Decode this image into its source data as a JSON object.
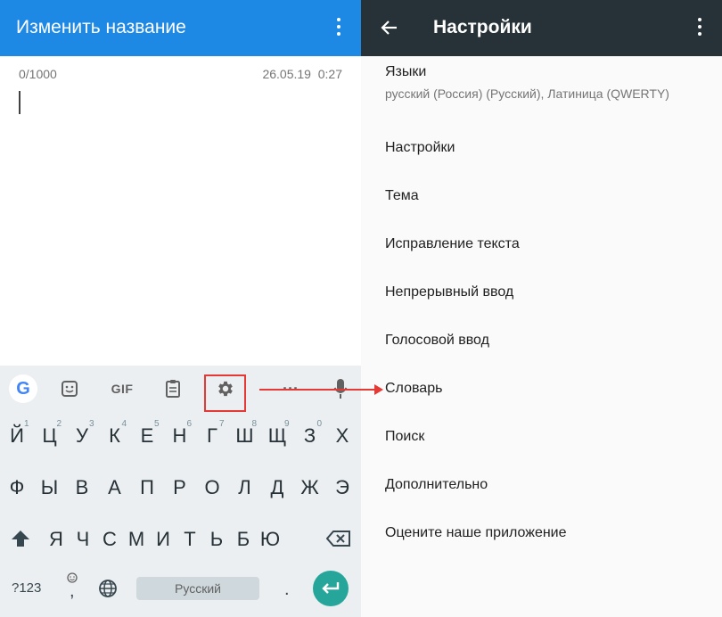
{
  "left": {
    "title": "Изменить название",
    "counter": "0/1000",
    "date": "26.05.19",
    "time": "0:27"
  },
  "keyboard": {
    "toolbar": {
      "google": "G",
      "gif": "GIF",
      "more": "···"
    },
    "row1": {
      "keys": [
        "Й",
        "Ц",
        "У",
        "К",
        "Е",
        "Н",
        "Г",
        "Ш",
        "Щ",
        "З",
        "Х"
      ],
      "hints": [
        "1",
        "2",
        "3",
        "4",
        "5",
        "6",
        "7",
        "8",
        "9",
        "0"
      ]
    },
    "row2": {
      "keys": [
        "Ф",
        "Ы",
        "В",
        "А",
        "П",
        "Р",
        "О",
        "Л",
        "Д",
        "Ж",
        "Э"
      ]
    },
    "row3": {
      "keys": [
        "Я",
        "Ч",
        "С",
        "М",
        "И",
        "Т",
        "Ь",
        "Б",
        "Ю"
      ]
    },
    "bottom": {
      "symbols": "?123",
      "emoji_comma": ",",
      "space_label": "Русский",
      "period": "."
    }
  },
  "settings": {
    "title": "Настройки",
    "languages": {
      "label": "Языки",
      "summary": "русский (Россия) (Русский), Латиница (QWERTY)"
    },
    "items": [
      "Настройки",
      "Тема",
      "Исправление текста",
      "Непрерывный ввод",
      "Голосовой ввод",
      "Словарь",
      "Поиск",
      "Дополнительно",
      "Оцените наше приложение"
    ]
  },
  "colors": {
    "left_app_bar": "#1e88e5",
    "right_app_bar": "#263238",
    "keyboard_bg": "#eceff1",
    "annotation": "#e53935",
    "enter_key": "#26a69a"
  },
  "icons": [
    "more-vert-icon",
    "back-arrow-icon",
    "google-icon",
    "sticker-icon",
    "clipboard-icon",
    "gear-icon",
    "mic-icon",
    "shift-icon",
    "backspace-icon",
    "globe-icon",
    "enter-icon"
  ]
}
